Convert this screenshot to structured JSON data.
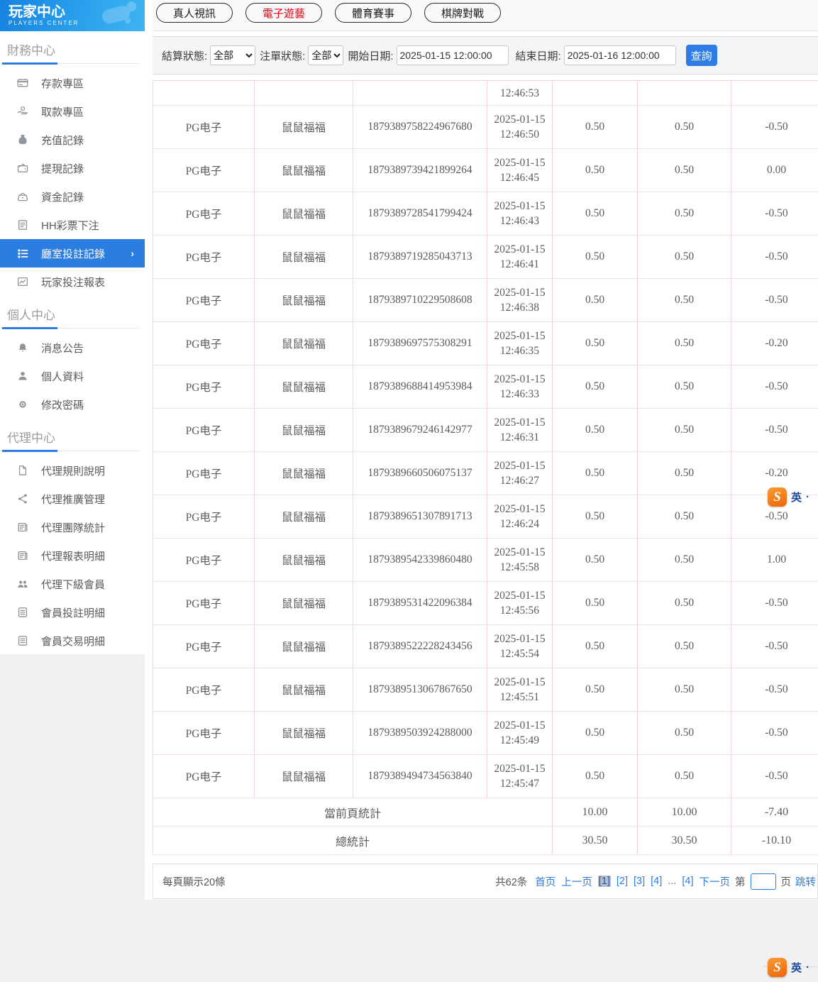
{
  "brand": {
    "title": "玩家中心",
    "subtitle": "PLAYERS CENTER"
  },
  "sidebar": {
    "sections": [
      {
        "title": "財務中心",
        "items": [
          {
            "label": "存款專區",
            "slug": "deposit-area",
            "icon": "bank-card"
          },
          {
            "label": "取款專區",
            "slug": "withdraw-area",
            "icon": "withdraw-hand"
          },
          {
            "label": "充值記錄",
            "slug": "recharge-records",
            "icon": "money-bag"
          },
          {
            "label": "提現記錄",
            "slug": "withdraw-records",
            "icon": "wallet"
          },
          {
            "label": "資金記錄",
            "slug": "fund-records",
            "icon": "purse"
          },
          {
            "label": "HH彩票下注",
            "slug": "hh-lottery-bets",
            "icon": "lottery-doc"
          },
          {
            "label": "廳室投註記錄",
            "slug": "room-bet-records",
            "icon": "bet-list",
            "active": true,
            "chevron": "›"
          },
          {
            "label": "玩家投注報表",
            "slug": "player-bet-report",
            "icon": "report-chart"
          }
        ]
      },
      {
        "title": "個人中心",
        "items": [
          {
            "label": "消息公告",
            "slug": "announcements",
            "icon": "bell"
          },
          {
            "label": "個人資料",
            "slug": "profile",
            "icon": "user"
          },
          {
            "label": "修改密碼",
            "slug": "change-password",
            "icon": "gear"
          }
        ]
      },
      {
        "title": "代理中心",
        "items": [
          {
            "label": "代理規則說明",
            "slug": "agent-rules",
            "icon": "doc"
          },
          {
            "label": "代理推廣管理",
            "slug": "agent-promotion",
            "icon": "share"
          },
          {
            "label": "代理團隊統計",
            "slug": "agent-team-stats",
            "icon": "clipboard"
          },
          {
            "label": "代理報表明細",
            "slug": "agent-report-detail",
            "icon": "clipboard"
          },
          {
            "label": "代理下級會員",
            "slug": "agent-sub-members",
            "icon": "users"
          },
          {
            "label": "會員投註明細",
            "slug": "member-bet-detail",
            "icon": "list-doc"
          },
          {
            "label": "會員交易明細",
            "slug": "member-trade-detail",
            "icon": "list-doc"
          }
        ]
      }
    ]
  },
  "tabs": [
    {
      "label": "真人視訊",
      "slug": "live-video",
      "active": false
    },
    {
      "label": "電子遊藝",
      "slug": "electronic-games",
      "active": true
    },
    {
      "label": "體育賽事",
      "slug": "sports-events",
      "active": false
    },
    {
      "label": "棋牌對戰",
      "slug": "board-card-battle",
      "active": false
    }
  ],
  "filters": {
    "settle_status": {
      "label": "結算狀態:",
      "value": "全部"
    },
    "order_status": {
      "label": "注單狀態:",
      "value": "全部"
    },
    "start_date": {
      "label": "開始日期:",
      "value": "2025-01-15 12:00:00"
    },
    "end_date": {
      "label": "結束日期:",
      "value": "2025-01-16 12:00:00"
    },
    "search_label": "查詢"
  },
  "table": {
    "rows": [
      {
        "provider": "",
        "game": "",
        "order_id": "",
        "date": "",
        "time": "12:46:53",
        "bet": "",
        "valid": "",
        "profit": "",
        "partial": true
      },
      {
        "provider": "PG电子",
        "game": "鼠鼠福福",
        "order_id": "1879389758224967680",
        "date": "2025-01-15",
        "time": "12:46:50",
        "bet": "0.50",
        "valid": "0.50",
        "profit": "-0.50"
      },
      {
        "provider": "PG电子",
        "game": "鼠鼠福福",
        "order_id": "1879389739421899264",
        "date": "2025-01-15",
        "time": "12:46:45",
        "bet": "0.50",
        "valid": "0.50",
        "profit": "0.00"
      },
      {
        "provider": "PG电子",
        "game": "鼠鼠福福",
        "order_id": "1879389728541799424",
        "date": "2025-01-15",
        "time": "12:46:43",
        "bet": "0.50",
        "valid": "0.50",
        "profit": "-0.50"
      },
      {
        "provider": "PG电子",
        "game": "鼠鼠福福",
        "order_id": "1879389719285043713",
        "date": "2025-01-15",
        "time": "12:46:41",
        "bet": "0.50",
        "valid": "0.50",
        "profit": "-0.50"
      },
      {
        "provider": "PG电子",
        "game": "鼠鼠福福",
        "order_id": "1879389710229508608",
        "date": "2025-01-15",
        "time": "12:46:38",
        "bet": "0.50",
        "valid": "0.50",
        "profit": "-0.50"
      },
      {
        "provider": "PG电子",
        "game": "鼠鼠福福",
        "order_id": "1879389697575308291",
        "date": "2025-01-15",
        "time": "12:46:35",
        "bet": "0.50",
        "valid": "0.50",
        "profit": "-0.20"
      },
      {
        "provider": "PG电子",
        "game": "鼠鼠福福",
        "order_id": "1879389688414953984",
        "date": "2025-01-15",
        "time": "12:46:33",
        "bet": "0.50",
        "valid": "0.50",
        "profit": "-0.50"
      },
      {
        "provider": "PG电子",
        "game": "鼠鼠福福",
        "order_id": "1879389679246142977",
        "date": "2025-01-15",
        "time": "12:46:31",
        "bet": "0.50",
        "valid": "0.50",
        "profit": "-0.50"
      },
      {
        "provider": "PG电子",
        "game": "鼠鼠福福",
        "order_id": "1879389660506075137",
        "date": "2025-01-15",
        "time": "12:46:27",
        "bet": "0.50",
        "valid": "0.50",
        "profit": "-0.20"
      },
      {
        "provider": "PG电子",
        "game": "鼠鼠福福",
        "order_id": "1879389651307891713",
        "date": "2025-01-15",
        "time": "12:46:24",
        "bet": "0.50",
        "valid": "0.50",
        "profit": "-0.50"
      },
      {
        "provider": "PG电子",
        "game": "鼠鼠福福",
        "order_id": "1879389542339860480",
        "date": "2025-01-15",
        "time": "12:45:58",
        "bet": "0.50",
        "valid": "0.50",
        "profit": "1.00"
      },
      {
        "provider": "PG电子",
        "game": "鼠鼠福福",
        "order_id": "1879389531422096384",
        "date": "2025-01-15",
        "time": "12:45:56",
        "bet": "0.50",
        "valid": "0.50",
        "profit": "-0.50"
      },
      {
        "provider": "PG电子",
        "game": "鼠鼠福福",
        "order_id": "1879389522228243456",
        "date": "2025-01-15",
        "time": "12:45:54",
        "bet": "0.50",
        "valid": "0.50",
        "profit": "-0.50"
      },
      {
        "provider": "PG电子",
        "game": "鼠鼠福福",
        "order_id": "1879389513067867650",
        "date": "2025-01-15",
        "time": "12:45:51",
        "bet": "0.50",
        "valid": "0.50",
        "profit": "-0.50"
      },
      {
        "provider": "PG电子",
        "game": "鼠鼠福福",
        "order_id": "1879389503924288000",
        "date": "2025-01-15",
        "time": "12:45:49",
        "bet": "0.50",
        "valid": "0.50",
        "profit": "-0.50"
      },
      {
        "provider": "PG电子",
        "game": "鼠鼠福福",
        "order_id": "1879389494734563840",
        "date": "2025-01-15",
        "time": "12:45:47",
        "bet": "0.50",
        "valid": "0.50",
        "profit": "-0.50"
      }
    ],
    "summary": [
      {
        "label": "當前頁統計",
        "bet": "10.00",
        "valid": "10.00",
        "profit": "-7.40"
      },
      {
        "label": "總統計",
        "bet": "30.50",
        "valid": "30.50",
        "profit": "-10.10"
      }
    ]
  },
  "pagination": {
    "page_size_label": "每頁顯示20條",
    "total_label": "共62条",
    "links": [
      {
        "label": "首页"
      },
      {
        "label": "上一页"
      },
      {
        "label": "[1]",
        "current": true
      },
      {
        "label": "[2]"
      },
      {
        "label": "[3]"
      },
      {
        "label": "[4]"
      },
      {
        "label": "..."
      },
      {
        "label": "[4]"
      },
      {
        "label": "下一页"
      }
    ],
    "jump_prefix": "第",
    "jump_suffix": "页",
    "jump_action": "跳转",
    "jump_value": ""
  },
  "ime": {
    "letter": "S",
    "mode": "英",
    "dot": "·"
  },
  "colors": {
    "accent": "#2b7de0",
    "tab_active": "#e60012",
    "link": "#2d7cdb",
    "table_border": "#f3d5d5"
  }
}
